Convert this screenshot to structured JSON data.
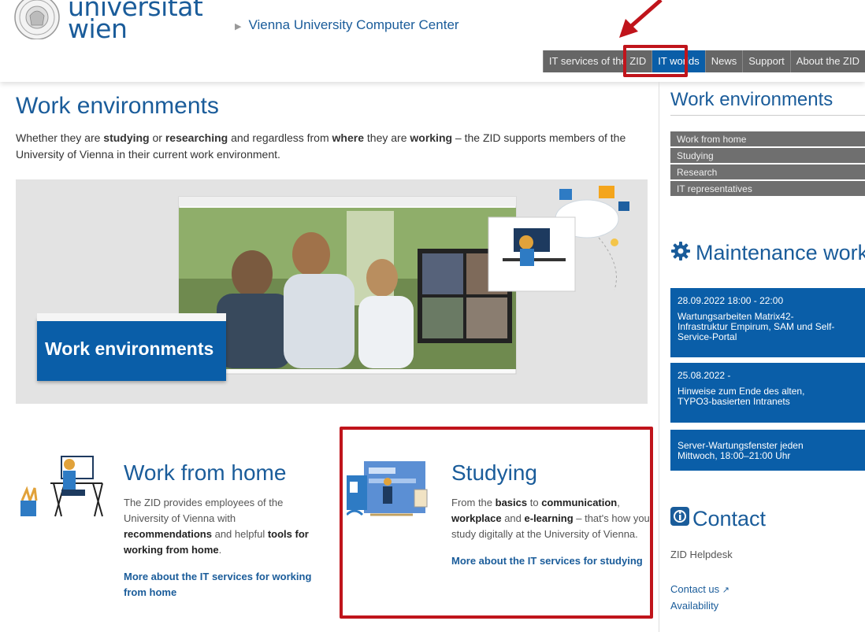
{
  "header": {
    "logo_line1": "universität",
    "logo_line2": "wien",
    "breadcrumb_arrow": "▶",
    "breadcrumb": "Vienna University Computer Center"
  },
  "topnav": [
    {
      "label": "IT services of the ZID",
      "active": false
    },
    {
      "label": "IT worlds",
      "active": true
    },
    {
      "label": "News",
      "active": false
    },
    {
      "label": "Support",
      "active": false
    },
    {
      "label": "About the ZID",
      "active": false
    }
  ],
  "main": {
    "title": "Work environments",
    "intro": {
      "t1": "Whether they are ",
      "b1": "studying",
      "t2": " or ",
      "b2": "researching",
      "t3": " and regardless from ",
      "b3": "where",
      "t4": " they are ",
      "b4": "working",
      "t5": " – the ZID supports members of the University of Vienna in their current work environment."
    },
    "hero_badge": "Work environments",
    "cards": {
      "home": {
        "title": "Work from home",
        "t1": "The ZID provides employees of the University of Vienna with ",
        "b1": "recommendations",
        "t2": " and helpful ",
        "b2": "tools for working from home",
        "t3": ".",
        "link": "More about the IT services for working from home"
      },
      "studying": {
        "title": "Studying",
        "t1": "From the ",
        "b1": "basics",
        "t2": " to ",
        "b2": "communication",
        "t3": ", ",
        "b3": "workplace",
        "t4": " and ",
        "b4": "e-learning",
        "t5": " – that's how you study digitally at the University of Vienna.",
        "link": "More about the IT services for studying"
      }
    }
  },
  "sidebar": {
    "title": "Work environments",
    "menu": [
      "Work from home",
      "Studying",
      "Research",
      "IT representatives"
    ],
    "maintenance_title": "Maintenance work",
    "maintenance": [
      {
        "date": "28.09.2022 18:00 - 22:00",
        "text": "Wartungsarbeiten Matrix42-Infrastruktur Empirum, SAM und Self-Service-Portal"
      },
      {
        "date": "25.08.2022 -",
        "text": "Hinweise zum Ende des alten, TYPO3-basierten Intranets"
      },
      {
        "date": "",
        "text": "Server-Wartungsfenster jeden Mittwoch, 18:00–21:00 Uhr"
      }
    ],
    "contact_title": "Contact",
    "helpdesk": "ZID Helpdesk",
    "contact_link": "Contact us",
    "contact_link_arrow": "↗",
    "availability": "Availability"
  },
  "colors": {
    "brand_blue": "#0a5ea8",
    "nav_gray": "#666666",
    "highlight_red": "#c0141b"
  }
}
